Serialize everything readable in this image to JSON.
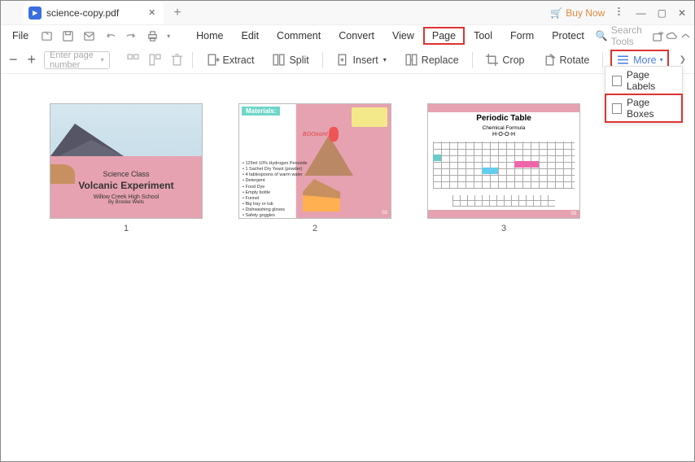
{
  "titlebar": {
    "filename": "science-copy.pdf",
    "buy": "Buy Now"
  },
  "menu": {
    "file": "File",
    "home": "Home",
    "edit": "Edit",
    "comment": "Comment",
    "convert": "Convert",
    "view": "View",
    "page": "Page",
    "tool": "Tool",
    "form": "Form",
    "protect": "Protect",
    "search": "Search Tools"
  },
  "toolbar": {
    "page_placeholder": "Enter page number",
    "extract": "Extract",
    "split": "Split",
    "insert": "Insert",
    "replace": "Replace",
    "crop": "Crop",
    "rotate": "Rotate",
    "more": "More"
  },
  "dropdown": {
    "labels": "Page Labels",
    "boxes": "Page Boxes"
  },
  "pages": [
    {
      "num": "1",
      "title1": "Science Class",
      "title2": "Volcanic Experiment",
      "sub1": "Willow Creek High School",
      "sub2": "By Brooke Wells"
    },
    {
      "num": "2",
      "materials": "Materials:",
      "boom": "BOOoom!",
      "list": "• 125ml 10% Hydrogen Peroxide\n• 1 Sachet Dry Yeast (powder)\n• 4 tablespoons of warm water\n• Detergent\n• Food Dye\n• Empty bottle\n• Funnel\n• Big tray or tub\n• Dishwashing gloves\n• Safety goggles",
      "pg": "02"
    },
    {
      "num": "3",
      "title": "Periodic Table",
      "sub": "Chemical Formula",
      "formula": "H-O-O-H",
      "pg": "03"
    }
  ]
}
